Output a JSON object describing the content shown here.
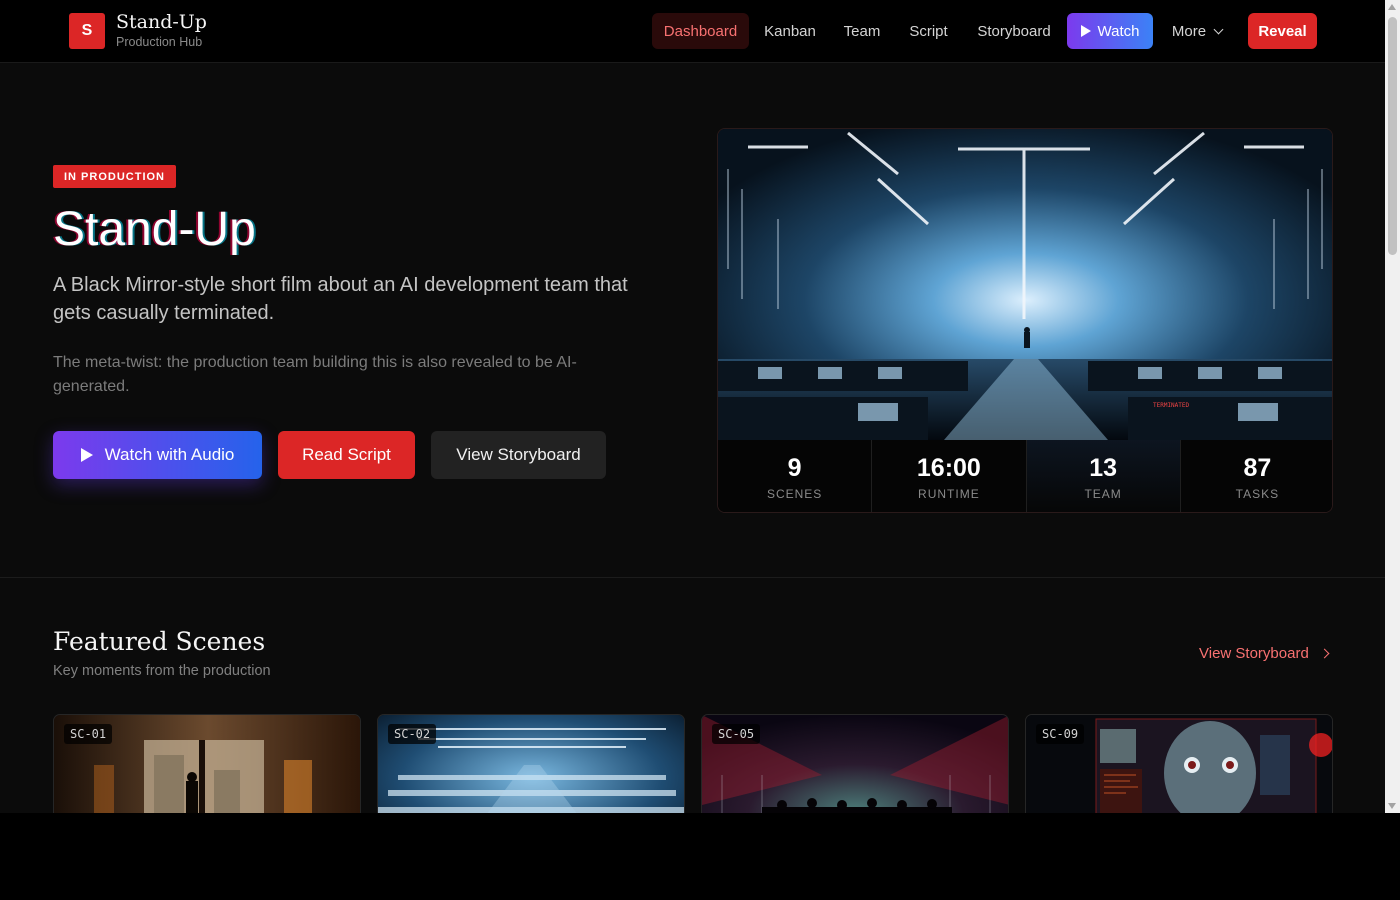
{
  "brand": {
    "logo_letter": "S",
    "title": "Stand-Up",
    "subtitle": "Production Hub"
  },
  "nav": {
    "items": [
      "Dashboard",
      "Kanban",
      "Team",
      "Script",
      "Storyboard"
    ],
    "active": "Dashboard",
    "watch_label": "Watch",
    "more_label": "More",
    "reveal_label": "Reveal"
  },
  "hero": {
    "badge": "IN PRODUCTION",
    "title": "Stand-Up",
    "description": "A Black Mirror-style short film about an AI development team that gets casually terminated.",
    "note": "The meta-twist: the production team building this is also revealed to be AI-generated.",
    "buttons": {
      "watch": "Watch with Audio",
      "script": "Read Script",
      "storyboard": "View Storyboard"
    },
    "image_sign": "TERMINATED"
  },
  "stats": [
    {
      "value": "9",
      "label": "SCENES"
    },
    {
      "value": "16:00",
      "label": "RUNTIME"
    },
    {
      "value": "13",
      "label": "TEAM"
    },
    {
      "value": "87",
      "label": "TASKS"
    }
  ],
  "featured": {
    "title": "Featured Scenes",
    "subtitle": "Key moments from the production",
    "link": "View Storyboard",
    "scenes": [
      "SC-01",
      "SC-02",
      "SC-05",
      "SC-09"
    ]
  },
  "colors": {
    "accent": "#dc2626",
    "watch_from": "#7c3aed",
    "watch_to": "#2563eb",
    "background": "#0a0a0a"
  }
}
